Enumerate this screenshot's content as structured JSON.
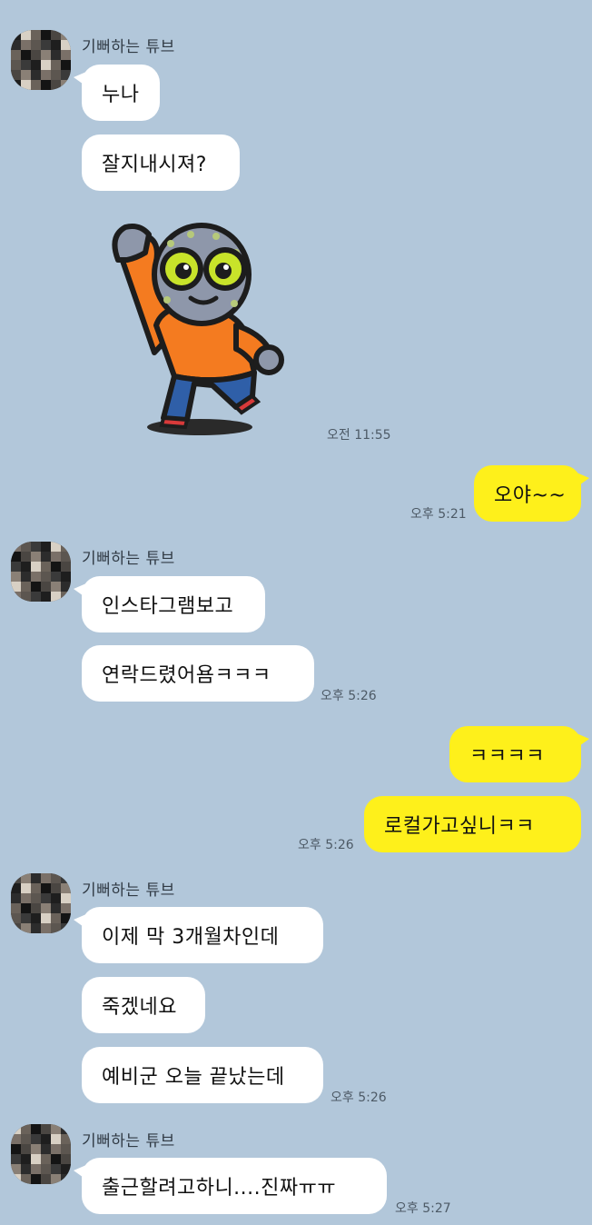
{
  "colors": {
    "background": "#b2c7da",
    "incoming_bubble": "#ffffff",
    "outgoing_bubble": "#fef01b"
  },
  "messages": {
    "g1": {
      "sender": "기뻐하는 튜브",
      "m1": "누나",
      "m2": "잘지내시져?",
      "sticker": "waving-tube-character-sticker",
      "time": "오전 11:55"
    },
    "out1": {
      "m1": "오야~~",
      "time": "오후 5:21"
    },
    "g2": {
      "sender": "기뻐하는 튜브",
      "m1": "인스타그램보고",
      "m2": "연락드렸어욤ㅋㅋㅋ",
      "time": "오후 5:26"
    },
    "out2": {
      "m1": "ㅋㅋㅋㅋ",
      "m2": "로컬가고싶니ㅋㅋ",
      "time": "오후 5:26"
    },
    "g3": {
      "sender": "기뻐하는 튜브",
      "m1": "이제 막 3개월차인데",
      "m2": "죽겠네요",
      "m3": "예비군 오늘 끝났는데",
      "time": "오후 5:26"
    },
    "g4": {
      "sender": "기뻐하는 튜브",
      "m1": "출근할려고하니....진짜ㅠㅠ",
      "time": "오후 5:27"
    }
  }
}
